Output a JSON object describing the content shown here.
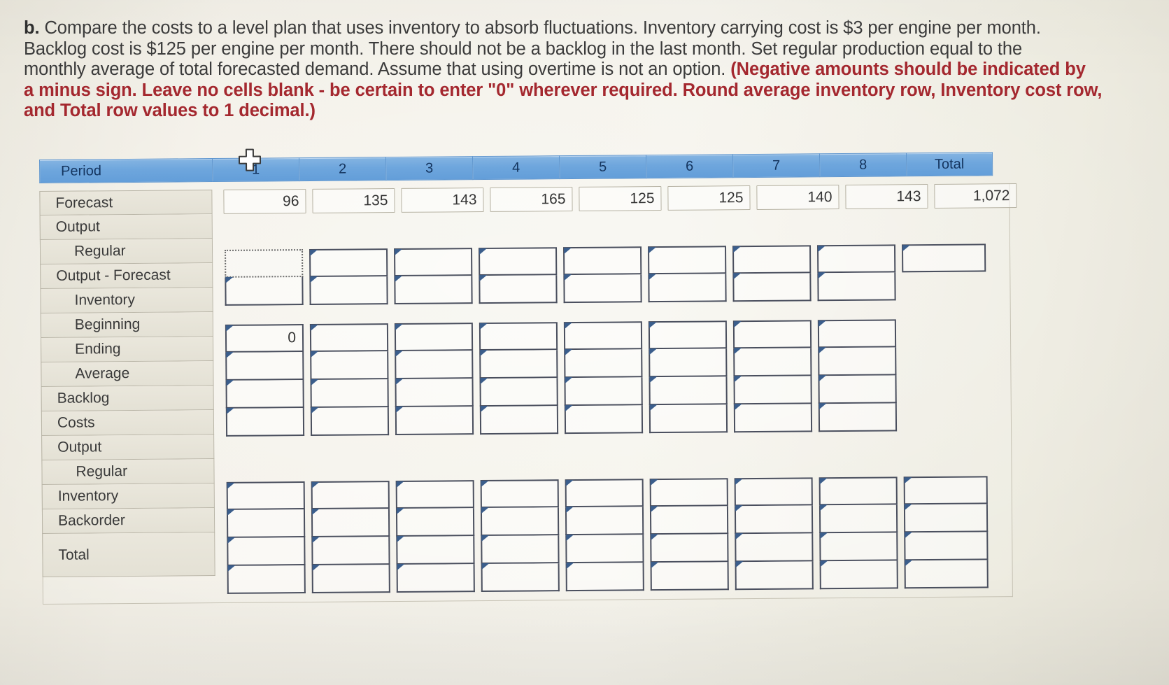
{
  "prompt": {
    "label": "b.",
    "lines": [
      {
        "segments": [
          {
            "text": "b. ",
            "style": "bold"
          },
          {
            "text": "Compare the costs to a level plan that uses inventory to absorb fluctuations. Inventory carrying cost is $3 per engine per month.",
            "style": "normal"
          }
        ]
      },
      {
        "segments": [
          {
            "text": "Backlog cost is $125 per engine per month. There should not be a backlog in the last month. Set regular production equal to the",
            "style": "normal"
          }
        ]
      },
      {
        "segments": [
          {
            "text": "monthly average of total forecasted demand. Assume that using overtime is not an option. ",
            "style": "normal"
          },
          {
            "text": "(Negative amounts should be indicated by",
            "style": "red"
          }
        ]
      },
      {
        "segments": [
          {
            "text": "a minus sign. Leave no cells blank - be certain to enter \"0\" wherever required. Round average inventory row, Inventory cost row,",
            "style": "red"
          }
        ]
      },
      {
        "segments": [
          {
            "text": "and Total row values to 1 decimal.)",
            "style": "red"
          }
        ]
      }
    ],
    "full_text_note": "b. Compare the costs to a level plan that uses inventory to absorb fluctuations. Inventory carrying cost is $3 per engine per month. Backlog cost is $125 per engine per month. There should not be a backlog in the last month. Set regular production equal to the monthly average of total forecasted demand. Assume that using overtime is not an option. (Negative amounts should be indicated by a minus sign. Leave no cells blank - be certain to enter \"0\" wherever required. Round average inventory row, Inventory cost row, and Total row values to 1 decimal.)"
  },
  "colors": {
    "header_blue": "#6ea6dd",
    "header_text": "#14345e",
    "prompt_red": "#a4282f",
    "prompt_gray": "#3b3b3b",
    "entry_border": "#4a4f5e",
    "flag_blue": "#3b5e8c",
    "paper": "#f2efe6"
  },
  "table": {
    "header": {
      "label": "Period",
      "periods": [
        "1",
        "2",
        "3",
        "4",
        "5",
        "6",
        "7",
        "8"
      ],
      "total": "Total"
    },
    "row_labels": [
      {
        "id": "forecast",
        "text": "Forecast",
        "indent": false
      },
      {
        "id": "output",
        "text": "Output",
        "indent": false
      },
      {
        "id": "output-regular",
        "text": "Regular",
        "indent": true
      },
      {
        "id": "output-forecast",
        "text": "Output - Forecast",
        "indent": false
      },
      {
        "id": "inventory",
        "text": "Inventory",
        "indent": true
      },
      {
        "id": "inv-beginning",
        "text": "Beginning",
        "indent": true
      },
      {
        "id": "inv-ending",
        "text": "Ending",
        "indent": true
      },
      {
        "id": "inv-average",
        "text": "Average",
        "indent": true
      },
      {
        "id": "backlog",
        "text": "Backlog",
        "indent": false
      },
      {
        "id": "costs",
        "text": "Costs",
        "indent": false
      },
      {
        "id": "costs-output",
        "text": "Output",
        "indent": false
      },
      {
        "id": "costs-regular",
        "text": "Regular",
        "indent": true
      },
      {
        "id": "costs-inventory",
        "text": "Inventory",
        "indent": false
      },
      {
        "id": "costs-backorder",
        "text": "Backorder",
        "indent": false
      },
      {
        "id": "costs-total",
        "text": "Total",
        "indent": false
      }
    ],
    "forecast_row": {
      "values": [
        "96",
        "135",
        "143",
        "165",
        "125",
        "125",
        "140",
        "143"
      ],
      "total": "1,072"
    },
    "entry_values": {
      "output_regular": [
        "",
        "",
        "",
        "",
        "",
        "",
        "",
        ""
      ],
      "output_regular_total": "",
      "output_minus_forecast": [
        "",
        "",
        "",
        "",
        "",
        "",
        "",
        ""
      ],
      "inventory_beginning": [
        "0",
        "",
        "",
        "",
        "",
        "",
        "",
        ""
      ],
      "inventory_ending": [
        "",
        "",
        "",
        "",
        "",
        "",
        "",
        ""
      ],
      "inventory_average": [
        "",
        "",
        "",
        "",
        "",
        "",
        "",
        ""
      ],
      "backlog": [
        "",
        "",
        "",
        "",
        "",
        "",
        "",
        ""
      ],
      "costs_regular": [
        "",
        "",
        "",
        "",
        "",
        "",
        "",
        ""
      ],
      "costs_regular_total": "",
      "costs_inventory": [
        "",
        "",
        "",
        "",
        "",
        "",
        "",
        ""
      ],
      "costs_inventory_total": "",
      "costs_backorder": [
        "",
        "",
        "",
        "",
        "",
        "",
        "",
        ""
      ],
      "costs_backorder_total": "",
      "costs_total": [
        "",
        "",
        "",
        "",
        "",
        "",
        "",
        ""
      ],
      "costs_total_total": ""
    },
    "selected_cell": {
      "row": "output_regular",
      "period": 1
    }
  },
  "cursor": {
    "icon": "crosshair-plus-cursor"
  }
}
